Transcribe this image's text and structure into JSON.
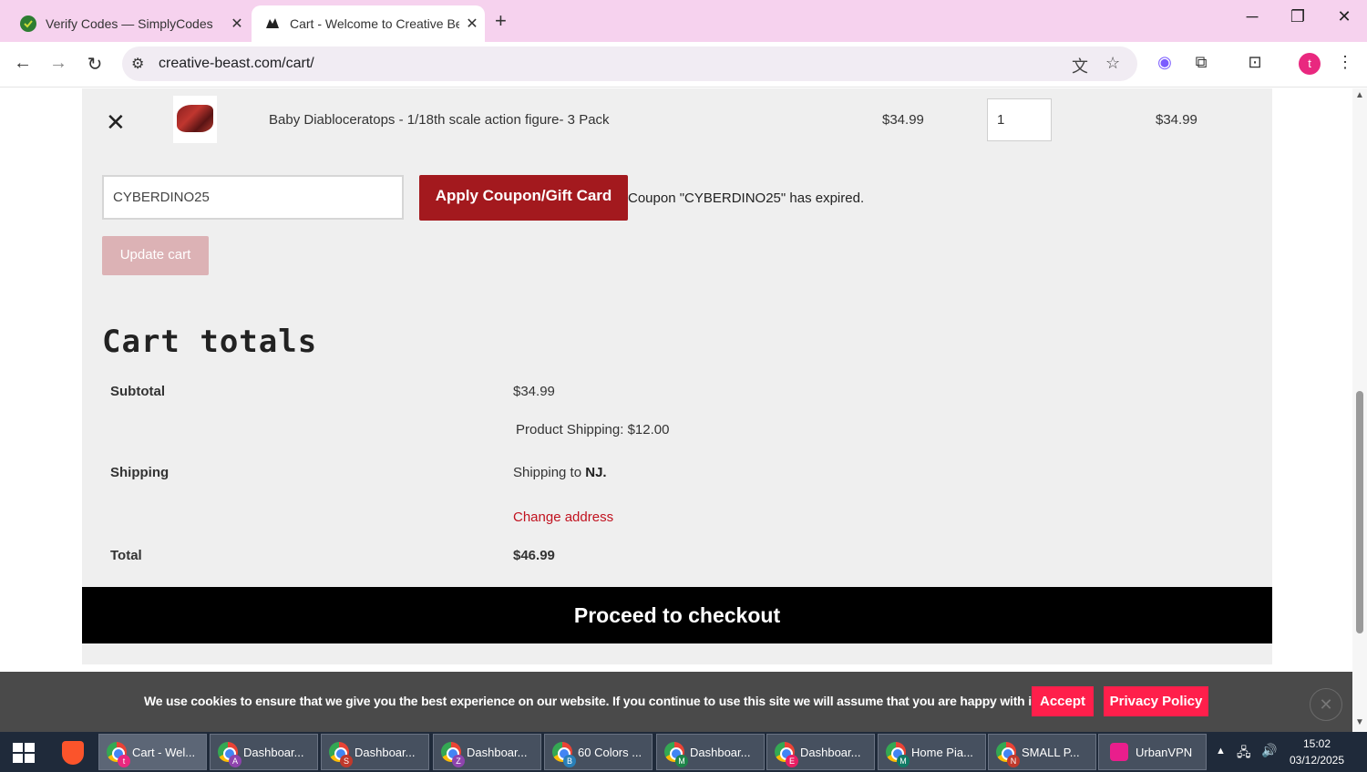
{
  "browser": {
    "tabs": [
      {
        "title": "Verify Codes — SimplyCodes",
        "active": false
      },
      {
        "title": "Cart - Welcome to Creative Beast",
        "active": true
      }
    ],
    "url": "creative-beast.com/cart/",
    "profile_initial": "t"
  },
  "cart": {
    "item": {
      "name": "Baby Diabloceratops - 1/18th scale action figure- 3 Pack",
      "price": "$34.99",
      "quantity": "1",
      "subtotal": "$34.99"
    },
    "coupon": {
      "value": "CYBERDINO25",
      "apply_label": "Apply Coupon/Gift Card",
      "message": "Coupon \"CYBERDINO25\" has expired."
    },
    "update_label": "Update cart"
  },
  "totals": {
    "title": "Cart totals",
    "subtotal_label": "Subtotal",
    "subtotal_value": "$34.99",
    "product_shipping": "Product Shipping: $12.00",
    "shipping_label": "Shipping",
    "shipping_to_prefix": "Shipping to",
    "shipping_to_state": "NJ.",
    "change_address": "Change address",
    "total_label": "Total",
    "total_value": "$46.99",
    "checkout_label": "Proceed to checkout"
  },
  "cookie_banner": {
    "text": "We use cookies to ensure that we give you the best experience on our website. If you continue to use this site we will assume that you are happy with it.",
    "accept_label": "Accept",
    "privacy_label": "Privacy Policy"
  },
  "taskbar": {
    "items": [
      {
        "label": "Cart - Wel...",
        "badge": "t",
        "badge_color": "#e9287f",
        "active": true
      },
      {
        "label": "Dashboar...",
        "badge": "A",
        "badge_color": "#8e44ad"
      },
      {
        "label": "Dashboar...",
        "badge": "S",
        "badge_color": "#c0392b"
      },
      {
        "label": "Dashboar...",
        "badge": "Z",
        "badge_color": "#8e44ad"
      },
      {
        "label": "60 Colors ...",
        "badge": "B",
        "badge_color": "#2980b9"
      },
      {
        "label": "Dashboar...",
        "badge": "M",
        "badge_color": "#1e8449"
      },
      {
        "label": "Dashboar...",
        "badge": "E",
        "badge_color": "#e91e63"
      },
      {
        "label": "Home Pia...",
        "badge": "M",
        "badge_color": "#117a65"
      },
      {
        "label": "SMALL P...",
        "badge": "N",
        "badge_color": "#c0392b"
      },
      {
        "label": "UrbanVPN",
        "badge": "",
        "badge_color": "#e91e8c"
      }
    ],
    "time": "15:02",
    "date": "03/12/2025"
  },
  "colors": {
    "tabstrip": "#f6d2ee",
    "apply_button": "#a3191e",
    "update_button": "#dcb2b5",
    "link_red": "#c1121f",
    "cookie_button": "#ff1f4b"
  }
}
